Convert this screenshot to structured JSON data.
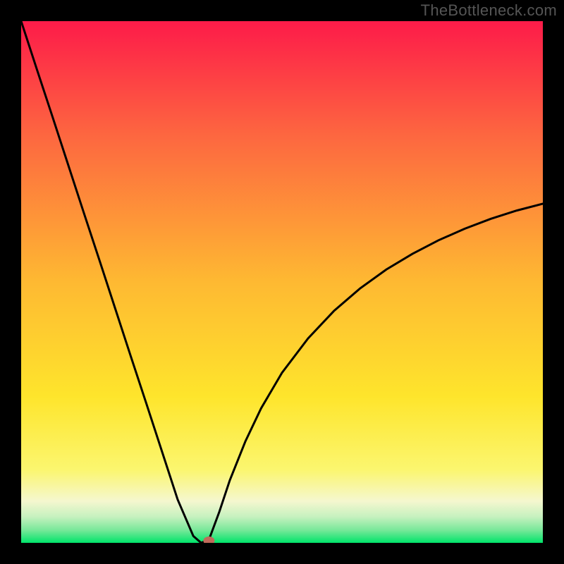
{
  "watermark": "TheBottleneck.com",
  "colors": {
    "frame": "#000000",
    "gradient_top": "#fd1b49",
    "gradient_mid_upper": "#fd7b3f",
    "gradient_mid": "#fee52c",
    "gradient_mid_lower": "#f7f59a",
    "gradient_band": "#b3efb0",
    "gradient_bottom": "#00e46a",
    "curve": "#000000",
    "marker": "#c06a5a"
  },
  "chart_data": {
    "type": "line",
    "title": "",
    "xlabel": "",
    "ylabel": "",
    "xlim": [
      0,
      100
    ],
    "ylim": [
      0,
      100
    ],
    "x": [
      0,
      3,
      6,
      9,
      12,
      15,
      18,
      21,
      24,
      27,
      30,
      33,
      34.5,
      36,
      38,
      40,
      43,
      46,
      50,
      55,
      60,
      65,
      70,
      75,
      80,
      85,
      90,
      95,
      100
    ],
    "values": [
      100,
      90.8,
      81.7,
      72.5,
      63.3,
      54.2,
      45.0,
      35.8,
      26.7,
      17.5,
      8.3,
      1.3,
      0.0,
      0.6,
      6.0,
      12.0,
      19.5,
      25.8,
      32.6,
      39.2,
      44.5,
      48.8,
      52.4,
      55.4,
      58.0,
      60.2,
      62.1,
      63.7,
      65.0
    ],
    "marker": {
      "x": 36.0,
      "y": 0.4
    },
    "annotations": []
  }
}
